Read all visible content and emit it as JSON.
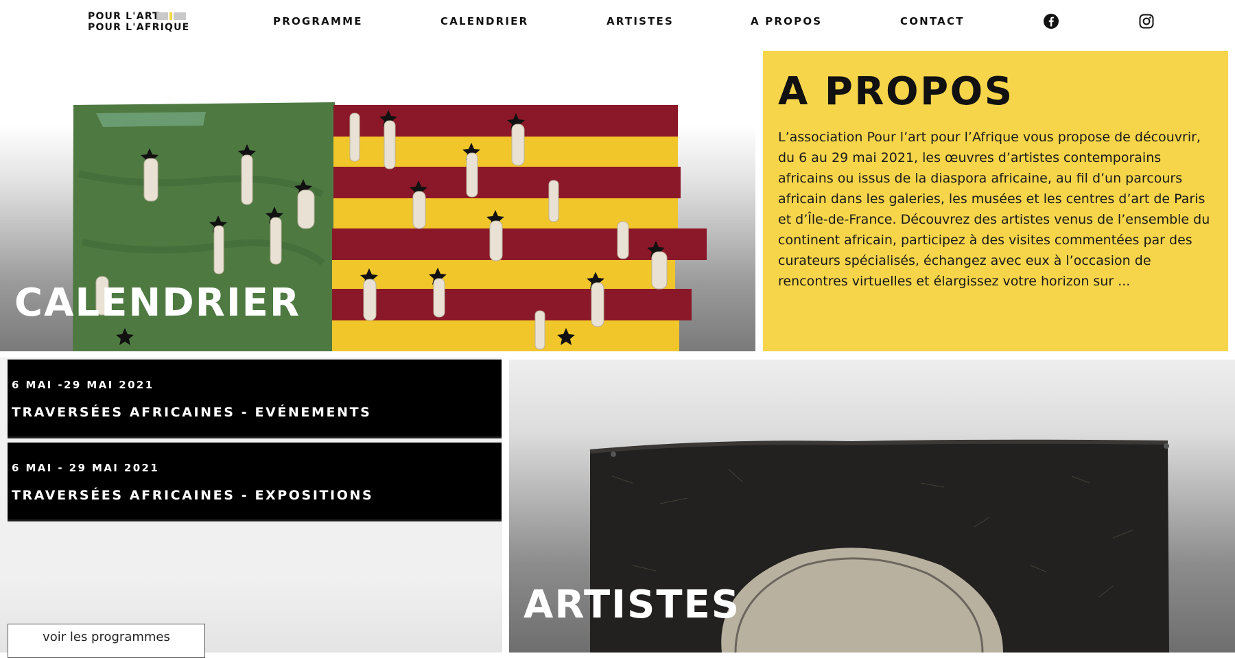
{
  "logo": {
    "line1": "POUR L'ART",
    "line2": "POUR L'AFRIQUE"
  },
  "nav": {
    "items": [
      "PROGRAMME",
      "CALENDRIER",
      "ARTISTES",
      "A PROPOS",
      "CONTACT"
    ],
    "social": [
      "facebook-icon",
      "instagram-icon"
    ]
  },
  "calendar_hero": {
    "title": "CALENDRIER"
  },
  "about": {
    "title": "A PROPOS",
    "text": "L’association Pour l’art pour l’Afrique vous propose de découvrir, du 6 au 29 mai 2021, les œuvres d’artistes contemporains africains ou issus de la diaspora africaine, au fil d’un parcours africain dans les galeries, les musées et les centres d’art de Paris et d’Île-de-France. Découvrez des artistes venus de l’ensemble du continent africain, participez à des visites commentées par des curateurs spécialisés, échangez avec eux à l’occasion de rencontres virtuelles et élargissez votre horizon sur ..."
  },
  "events": [
    {
      "date": "6 MAI -29 MAI 2021",
      "title": "TRAVERSÉES AFRICAINES - EVÉNEMENTS"
    },
    {
      "date": "6 MAI - 29 MAI 2021",
      "title": "TRAVERSÉES AFRICAINES - EXPOSITIONS"
    }
  ],
  "programme": {
    "button_label": "voir les programmes"
  },
  "artists_hero": {
    "title": "ARTISTES"
  },
  "colors": {
    "accent_yellow": "#f7d54a",
    "black": "#000000",
    "flag_green": "#4e7a42",
    "flag_red": "#8a1828",
    "flag_yellow": "#f1c62a"
  }
}
